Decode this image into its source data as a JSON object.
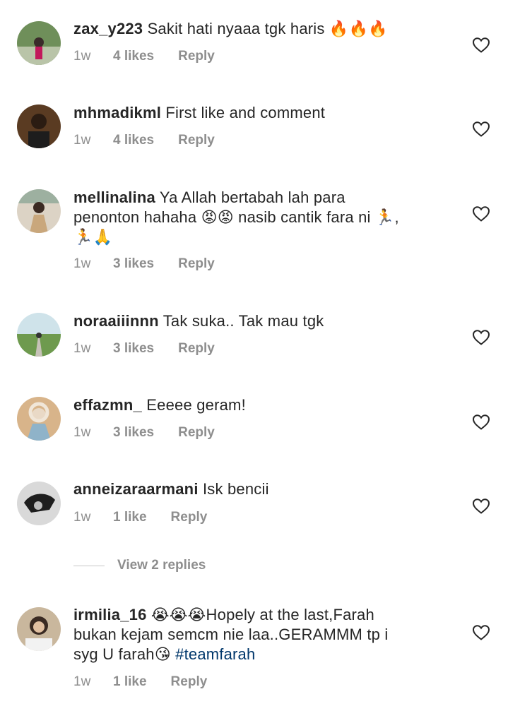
{
  "comments": [
    {
      "username": "zax_y223",
      "text_lines": [
        "Sakit hati nyaaa tgk haris 🔥🔥🔥"
      ],
      "time": "1w",
      "likes": "4 likes",
      "reply": "Reply"
    },
    {
      "username": "mhmadikml",
      "text_lines": [
        "First like and comment"
      ],
      "time": "1w",
      "likes": "4 likes",
      "reply": "Reply"
    },
    {
      "username": "mellinalina",
      "text_lines": [
        "Ya Allah bertabah lah para",
        "penonton hahaha 😡😡 nasib cantik fara ni 🏃,",
        "🏃🙏"
      ],
      "time": "1w",
      "likes": "3 likes",
      "reply": "Reply"
    },
    {
      "username": "noraaiiinnn",
      "text_lines": [
        "Tak suka.. Tak mau tgk"
      ],
      "time": "1w",
      "likes": "3 likes",
      "reply": "Reply"
    },
    {
      "username": "effazmn_",
      "text_lines": [
        "Eeeee geram!"
      ],
      "time": "1w",
      "likes": "3 likes",
      "reply": "Reply"
    },
    {
      "username": "anneizaraarmani",
      "text_lines": [
        "Isk bencii"
      ],
      "time": "1w",
      "likes": "1 like",
      "reply": "Reply"
    },
    {
      "username": "irmilia_16",
      "text_lines": [
        "😭😭😭Hopely at the last,Farah",
        "bukan kejam semcm nie laa..GERAMMM tp i",
        "syg U farah😘 "
      ],
      "hashtag": "#teamfarah",
      "time": "1w",
      "likes": "1 like",
      "reply": "Reply"
    }
  ],
  "view_replies": "View 2 replies",
  "colors": {
    "text": "#262626",
    "meta": "#8e8e8e",
    "hashtag": "#00376b",
    "divider": "#c7c7c7"
  },
  "icons": {
    "like": "heart-outline-icon"
  }
}
